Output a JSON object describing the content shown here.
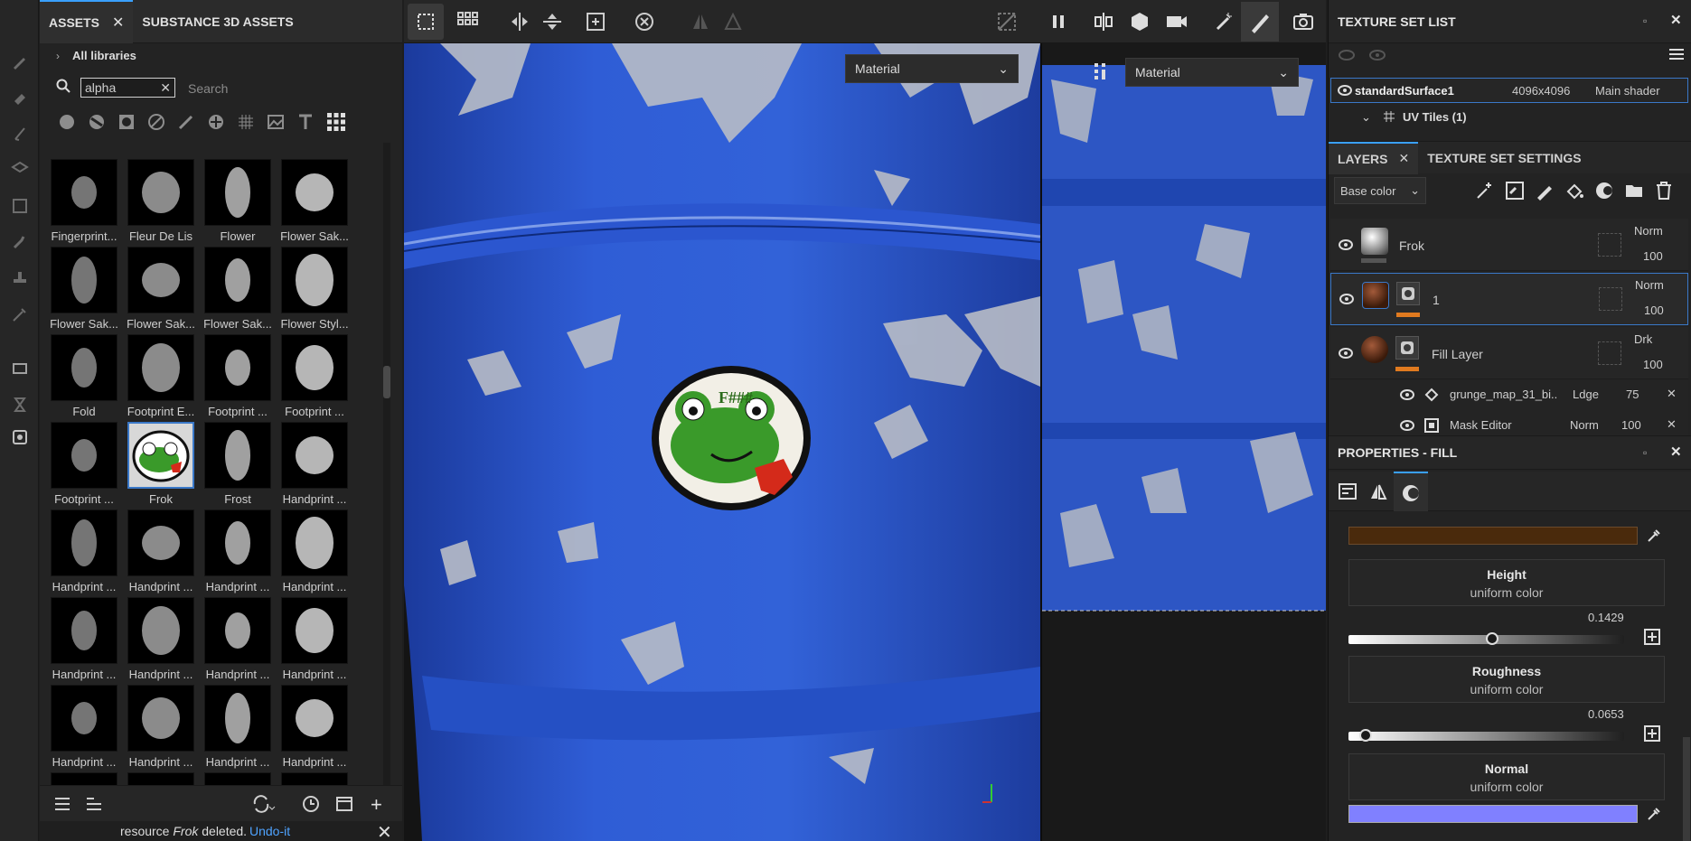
{
  "assets_panel": {
    "tabs": [
      "ASSETS",
      "SUBSTANCE 3D ASSETS"
    ],
    "breadcrumb": "All libraries",
    "search_value": "alpha",
    "search_placeholder": "Search",
    "items": [
      {
        "label": "Fingerprint..."
      },
      {
        "label": "Fleur De Lis"
      },
      {
        "label": "Flower"
      },
      {
        "label": "Flower Sak..."
      },
      {
        "label": "Flower Sak..."
      },
      {
        "label": "Flower Sak..."
      },
      {
        "label": "Flower Sak..."
      },
      {
        "label": "Flower Styl..."
      },
      {
        "label": "Fold"
      },
      {
        "label": "Footprint E..."
      },
      {
        "label": "Footprint ..."
      },
      {
        "label": "Footprint ..."
      },
      {
        "label": "Footprint ..."
      },
      {
        "label": "Frok"
      },
      {
        "label": "Frost"
      },
      {
        "label": "Handprint ..."
      },
      {
        "label": "Handprint ..."
      },
      {
        "label": "Handprint ..."
      },
      {
        "label": "Handprint ..."
      },
      {
        "label": "Handprint ..."
      },
      {
        "label": "Handprint ..."
      },
      {
        "label": "Handprint ..."
      },
      {
        "label": "Handprint ..."
      },
      {
        "label": "Handprint ..."
      },
      {
        "label": "Handprint ..."
      },
      {
        "label": "Handprint ..."
      },
      {
        "label": "Handprint ..."
      },
      {
        "label": "Handprint ..."
      }
    ],
    "selected_item": "Frok"
  },
  "notification": {
    "prefix": "resource ",
    "name": "Frok",
    "suffix": " deleted.",
    "undo": "Undo-it"
  },
  "viewport": {
    "left_mode": "Material",
    "right_mode": "Material",
    "sticker_text": "F###"
  },
  "texture_set_list": {
    "title": "TEXTURE SET LIST",
    "set_name": "standardSurface1",
    "resolution": "4096x4096",
    "shader": "Main shader",
    "uv_tiles": "UV Tiles (1)"
  },
  "layers_panel": {
    "tabs": [
      "LAYERS",
      "TEXTURE SET SETTINGS"
    ],
    "channel": "Base color",
    "layers": [
      {
        "name": "Frok",
        "blend": "Norm",
        "opacity": "100"
      },
      {
        "name": "1",
        "blend": "Norm",
        "opacity": "100"
      },
      {
        "name": "Fill Layer",
        "blend": "Drk",
        "opacity": "100"
      }
    ],
    "sublayers": [
      {
        "name": "grunge_map_31_bi...",
        "blend": "Ldge",
        "opacity": "75"
      },
      {
        "name": "Mask Editor",
        "blend": "Norm",
        "opacity": "100"
      }
    ]
  },
  "properties": {
    "title": "PROPERTIES - FILL",
    "channels": [
      {
        "name": "Height",
        "type": "uniform color",
        "value": "0.1429"
      },
      {
        "name": "Roughness",
        "type": "uniform color",
        "value": "0.0653"
      },
      {
        "name": "Normal",
        "type": "uniform color"
      }
    ],
    "height_level": 0.1429,
    "roughness_level": 0.0653,
    "base_color_swatch": "#4a2a0c",
    "normal_swatch": "#8080ff"
  },
  "colors": {
    "accent": "#3aa0ff",
    "selection": "#3a78c8",
    "orange": "#e07a1f",
    "barrel_blue": "#2a55c8"
  }
}
